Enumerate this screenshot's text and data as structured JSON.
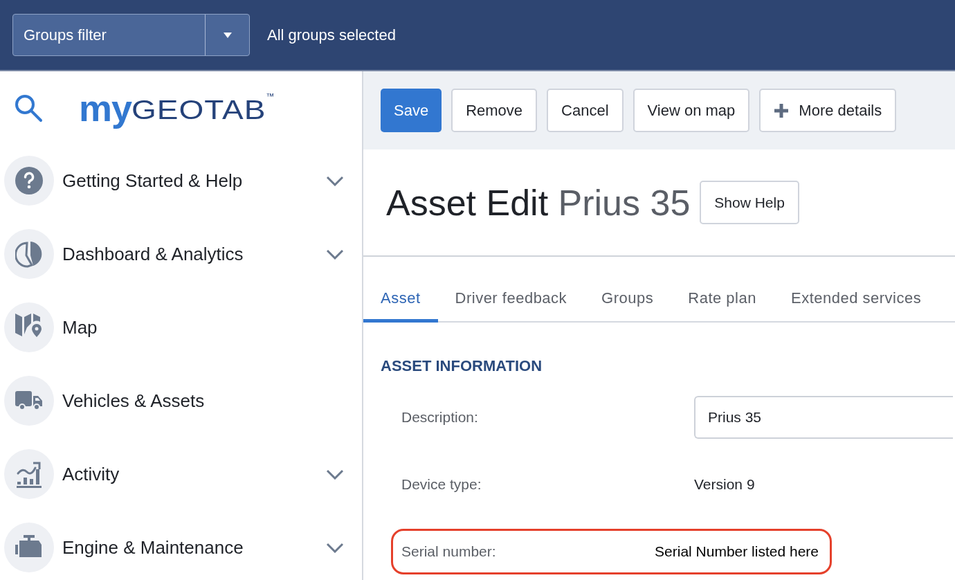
{
  "top_bar": {
    "groups_filter": {
      "value": "Groups filter"
    },
    "status": "All groups selected"
  },
  "sidebar": {
    "logo": {
      "prefix": "my",
      "name": "GEOTAB",
      "mark": "™"
    },
    "items": [
      {
        "label": "Getting Started & Help",
        "kind": "help",
        "expandable": true
      },
      {
        "label": "Dashboard & Analytics",
        "kind": "pie",
        "expandable": true
      },
      {
        "label": "Map",
        "kind": "map",
        "expandable": false
      },
      {
        "label": "Vehicles & Assets",
        "kind": "truck",
        "expandable": false
      },
      {
        "label": "Activity",
        "kind": "chart",
        "expandable": true
      },
      {
        "label": "Engine & Maintenance",
        "kind": "engine",
        "expandable": true
      }
    ]
  },
  "toolbar": {
    "buttons": [
      {
        "label": "Save",
        "kind": "primary"
      },
      {
        "label": "Remove",
        "kind": "plain"
      },
      {
        "label": "Cancel",
        "kind": "plain"
      },
      {
        "label": "View on map",
        "kind": "plain"
      },
      {
        "label": "More details",
        "kind": "plus"
      }
    ]
  },
  "header": {
    "title": "Asset Edit",
    "subtitle": "Prius 35",
    "help_button": "Show Help"
  },
  "tabs": [
    {
      "label": "Asset",
      "selected": true
    },
    {
      "label": "Driver feedback",
      "selected": false
    },
    {
      "label": "Groups",
      "selected": false
    },
    {
      "label": "Rate plan",
      "selected": false
    },
    {
      "label": "Extended services",
      "selected": false
    }
  ],
  "section": {
    "heading": "ASSET INFORMATION",
    "fields": [
      {
        "label": "Description:",
        "kind": "input",
        "value": "Prius 35",
        "highlighted": false
      },
      {
        "label": "Device type:",
        "kind": "text",
        "value": "Version 9",
        "highlighted": false
      },
      {
        "label": "Serial number:",
        "kind": "text",
        "value": "Serial Number listed here",
        "highlighted": true
      }
    ]
  }
}
